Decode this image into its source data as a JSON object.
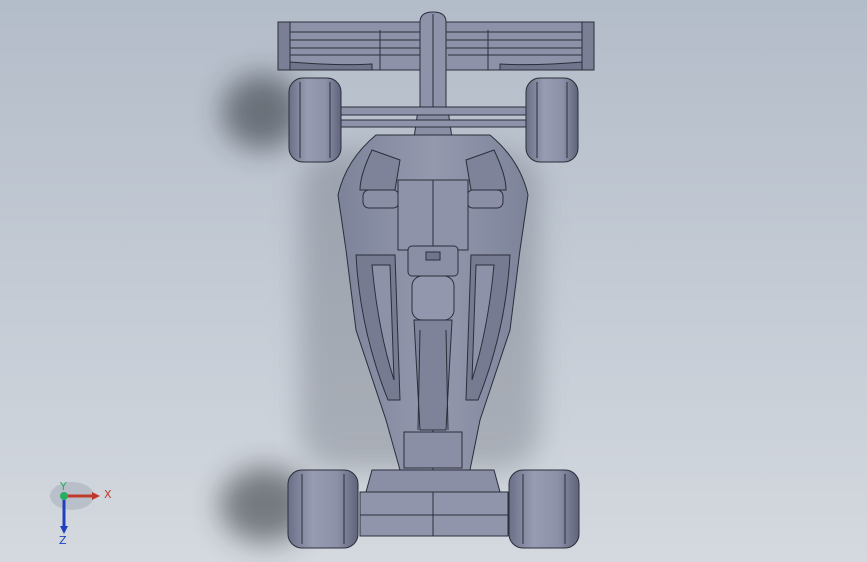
{
  "viewport": {
    "background_top": "#b3bcc9",
    "background_bottom": "#d4d9df",
    "part_color": "#8a90a6",
    "edge_color": "#2b2e3a"
  },
  "model": {
    "name": "formula-car-top-view"
  },
  "triad": {
    "x_label": "X",
    "y_label": "Y",
    "z_label": "Z",
    "x_color": "#c0392b",
    "y_color": "#27ae60",
    "z_color": "#1f3fbf"
  }
}
